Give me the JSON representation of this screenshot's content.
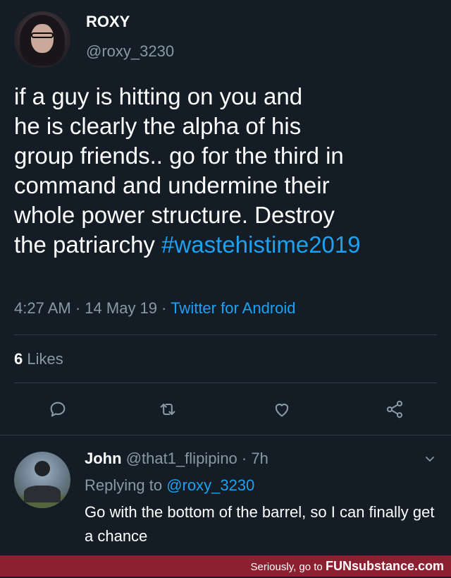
{
  "tweet": {
    "display_name": "ROXY",
    "handle": "@roxy_3230",
    "text_plain": "if a guy is hitting on you and\nhe is clearly the alpha of his\ngroup friends.. go for the third in\ncommand and undermine their\nwhole power structure. Destroy\nthe patriarchy ",
    "hashtag": "#wastehistime2019",
    "time": "4:27 AM",
    "date": "14 May 19",
    "separator": "·",
    "source": "Twitter for Android",
    "likes_count": "6",
    "likes_label": "Likes"
  },
  "actions": {
    "reply_icon": "reply-icon",
    "retweet_icon": "retweet-icon",
    "like_icon": "heart-icon",
    "share_icon": "share-icon"
  },
  "reply": {
    "name": "John",
    "handle": "@that1_flipipino",
    "separator": "·",
    "time": "7h",
    "replying_label": "Replying to",
    "replying_to": "@roxy_3230",
    "text": "Go with the bottom of the barrel, so I can finally get a chance"
  },
  "watermark": {
    "prefix": "Seriously, go to",
    "brand": "FUNsubstance.com"
  },
  "colors": {
    "background": "#141d26",
    "secondary_text": "#8899a6",
    "accent": "#1da1f2",
    "watermark_bg": "#8a2030"
  }
}
